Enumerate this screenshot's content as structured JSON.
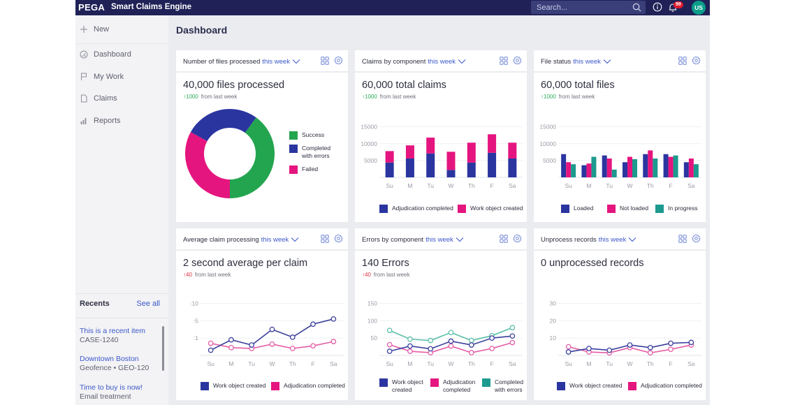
{
  "topbar": {
    "brand": "PEGA",
    "app_name": "Smart Claims Engine",
    "search_placeholder": "Search...",
    "notification_count": "99",
    "avatar_initials": "US",
    "colors": {
      "bar": "#1f2157",
      "avatar": "#0a9d8a",
      "badge": "#e0192d"
    }
  },
  "sidebar": {
    "new_label": "New",
    "items": [
      {
        "label": "Dashboard",
        "icon": "dashboard-gauge-icon"
      },
      {
        "label": "My Work",
        "icon": "flag-icon"
      },
      {
        "label": "Claims",
        "icon": "document-icon"
      },
      {
        "label": "Reports",
        "icon": "bar-chart-icon"
      }
    ],
    "recents": {
      "title": "Recents",
      "see_all": "See all",
      "items": [
        {
          "title": "This is a recent item",
          "subtitle": "CASE-1240"
        },
        {
          "title": "Downtown Boston",
          "subtitle": "Geofence • GEO-120"
        },
        {
          "title": "Time to buy is now!",
          "subtitle": "Email treatment"
        }
      ]
    }
  },
  "page": {
    "title": "Dashboard"
  },
  "colors": {
    "blue": "#2b35a0",
    "magenta": "#e5157f",
    "green": "#23a54f",
    "teal": "#1c9a8e",
    "link": "#3c58c9"
  },
  "cards": [
    {
      "title": "Number of files processed",
      "period": "this week",
      "kpi": "40,000 files processed",
      "delta_value": "1000",
      "delta_dir": "up",
      "delta_color": "green",
      "delta_text": "from last week"
    },
    {
      "title": "Claims by component",
      "period": "this week",
      "kpi": "60,000 total claims",
      "delta_value": "1000",
      "delta_dir": "up",
      "delta_color": "green",
      "delta_text": "from last week"
    },
    {
      "title": "File status",
      "period": "this week",
      "kpi": "60,000 total files",
      "delta_value": "1000",
      "delta_dir": "up",
      "delta_color": "green",
      "delta_text": "from last week"
    },
    {
      "title": "Average claim processing",
      "period": "this week",
      "kpi": "2 second average per claim",
      "delta_value": "40",
      "delta_dir": "up",
      "delta_color": "red",
      "delta_text": "from last week"
    },
    {
      "title": "Errors by component",
      "period": "this week",
      "kpi": "140 Errors",
      "delta_value": "40",
      "delta_dir": "up",
      "delta_color": "red",
      "delta_text": "from last week"
    },
    {
      "title": "Unprocess records",
      "period": "this week",
      "kpi": "0 unprocessed records",
      "delta_value": "",
      "delta_dir": "",
      "delta_color": "",
      "delta_text": ""
    }
  ],
  "chart_data": [
    {
      "type": "pie",
      "title": "Number of files processed",
      "donut": true,
      "slices": [
        {
          "name": "Success",
          "value": 40,
          "color": "#23a54f"
        },
        {
          "name": "Failed",
          "value": 33,
          "color": "#e5157f"
        },
        {
          "name": "Completed with errors",
          "value": 27,
          "color": "#2b35a0"
        }
      ],
      "legend": [
        "Success",
        "Completed with errors",
        "Failed"
      ],
      "legend_position": "right"
    },
    {
      "type": "bar",
      "stacked": true,
      "title": "Claims by component",
      "categories": [
        "Su",
        "M",
        "Tu",
        "W",
        "Th",
        "F",
        "Sa"
      ],
      "series": [
        {
          "name": "Adjudication completed",
          "color": "#2b35a0",
          "values": [
            4400,
            5600,
            7100,
            2200,
            4400,
            7300,
            5600
          ]
        },
        {
          "name": "Work object created",
          "color": "#e5157f",
          "values": [
            3400,
            3900,
            4700,
            5400,
            5900,
            5500,
            4700
          ]
        }
      ],
      "yticks": [
        5000,
        10000,
        15000
      ],
      "ylim": [
        0,
        17000
      ],
      "grid": true,
      "legend_position": "bottom"
    },
    {
      "type": "bar",
      "stacked": false,
      "title": "File status",
      "categories": [
        "Su",
        "M",
        "Tu",
        "W",
        "Th",
        "F",
        "Sa"
      ],
      "series": [
        {
          "name": "Loaded",
          "color": "#2b35a0",
          "values": [
            6900,
            3600,
            6500,
            4500,
            6900,
            6900,
            4500
          ]
        },
        {
          "name": "Not loaded",
          "color": "#e5157f",
          "values": [
            4500,
            4100,
            5600,
            6100,
            8000,
            6100,
            5600
          ]
        },
        {
          "name": "In progress",
          "color": "#1c9a8e",
          "values": [
            3900,
            6100,
            2300,
            5400,
            5600,
            6500,
            3900
          ]
        }
      ],
      "yticks": [
        5000,
        10000,
        15000
      ],
      "ylim": [
        0,
        17000
      ],
      "grid": true,
      "legend_position": "bottom"
    },
    {
      "type": "line",
      "title": "Average claim processing",
      "categories": [
        "Su",
        "M",
        "Tu",
        "W",
        "Th",
        "F",
        "Sa"
      ],
      "ytick_labels": [
        ":1",
        ":5",
        ":10"
      ],
      "note": "y axis is categorical-spaced; values expressed in tick-index units (0 = baseline, 1 = ':1', 2 = ':5', 3 = ':10')",
      "series": [
        {
          "name": "Work object created",
          "color": "#3b3f9c",
          "values": [
            0.3,
            0.9,
            0.6,
            1.5,
            1.05,
            1.8,
            2.1
          ]
        },
        {
          "name": "Adjudication completed",
          "color": "#e55ea6",
          "values": [
            0.7,
            0.45,
            0.4,
            0.65,
            0.4,
            0.55,
            0.8
          ]
        }
      ],
      "ylim": [
        0,
        3.3
      ],
      "grid": true,
      "legend_position": "bottom"
    },
    {
      "type": "line",
      "title": "Errors by component",
      "categories": [
        "Su",
        "M",
        "Tu",
        "W",
        "Th",
        "F",
        "Sa"
      ],
      "series": [
        {
          "name": "Work object created",
          "color": "#3b3f9c",
          "values": [
            12,
            27,
            19,
            41,
            30,
            50,
            56
          ]
        },
        {
          "name": "Adjudication completed",
          "color": "#e55ea6",
          "values": [
            31,
            12,
            8,
            27,
            8,
            20,
            37
          ]
        },
        {
          "name": "Completed with errors",
          "color": "#5cbfa9",
          "values": [
            72,
            47,
            43,
            66,
            43,
            57,
            80
          ]
        }
      ],
      "yticks": [
        50,
        100,
        150
      ],
      "ytick_labels": [
        "50",
        "100",
        "150"
      ],
      "ylim": [
        0,
        165
      ],
      "grid": true,
      "legend_position": "bottom"
    },
    {
      "type": "line",
      "title": "Unprocess records",
      "categories": [
        "Su",
        "M",
        "Tu",
        "W",
        "Th",
        "F",
        "Sa"
      ],
      "series": [
        {
          "name": "Work object created",
          "color": "#3b3f9c",
          "values": [
            2,
            4,
            3,
            6,
            4.5,
            7,
            7.5
          ]
        },
        {
          "name": "Adjudication completed",
          "color": "#e55ea6",
          "values": [
            5,
            2,
            1.5,
            4.5,
            1.5,
            3.5,
            6
          ]
        }
      ],
      "yticks": [
        10,
        20,
        30
      ],
      "ytick_labels": [
        "10",
        "20",
        "30"
      ],
      "ylim": [
        0,
        33
      ],
      "grid": true,
      "legend_position": "bottom"
    }
  ]
}
